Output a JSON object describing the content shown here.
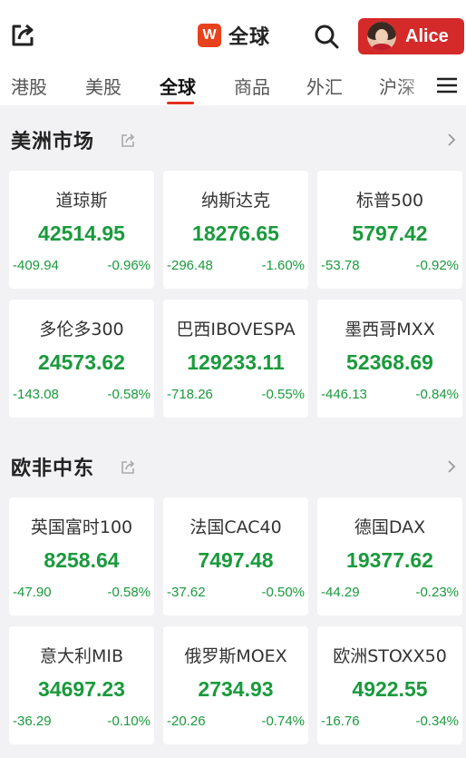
{
  "header": {
    "title": "全球",
    "logo_letter": "W",
    "user_name": "Alice"
  },
  "tabs": [
    {
      "label": "港股"
    },
    {
      "label": "美股"
    },
    {
      "label": "全球",
      "active": true
    },
    {
      "label": "商品"
    },
    {
      "label": "外汇"
    },
    {
      "label": "沪深"
    }
  ],
  "colors": {
    "accent_red": "#d42a2a",
    "down_green": "#1a9a3c",
    "brand_orange": "#e8421d"
  },
  "icons": {
    "share": "share-icon",
    "search": "search-icon",
    "menu": "menu-icon",
    "external_link": "external-link-icon",
    "chevron_right": "chevron-right-icon"
  },
  "sections": [
    {
      "title": "美洲市场",
      "cards": [
        {
          "name": "道琼斯",
          "price": "42514.95",
          "change": "-409.94",
          "change_pct": "-0.96%"
        },
        {
          "name": "纳斯达克",
          "price": "18276.65",
          "change": "-296.48",
          "change_pct": "-1.60%"
        },
        {
          "name": "标普500",
          "price": "5797.42",
          "change": "-53.78",
          "change_pct": "-0.92%"
        },
        {
          "name": "多伦多300",
          "price": "24573.62",
          "change": "-143.08",
          "change_pct": "-0.58%"
        },
        {
          "name": "巴西IBOVESPA",
          "price": "129233.11",
          "change": "-718.26",
          "change_pct": "-0.55%"
        },
        {
          "name": "墨西哥MXX",
          "price": "52368.69",
          "change": "-446.13",
          "change_pct": "-0.84%"
        }
      ]
    },
    {
      "title": "欧非中东",
      "cards": [
        {
          "name": "英国富时100",
          "price": "8258.64",
          "change": "-47.90",
          "change_pct": "-0.58%"
        },
        {
          "name": "法国CAC40",
          "price": "7497.48",
          "change": "-37.62",
          "change_pct": "-0.50%"
        },
        {
          "name": "德国DAX",
          "price": "19377.62",
          "change": "-44.29",
          "change_pct": "-0.23%"
        },
        {
          "name": "意大利MIB",
          "price": "34697.23",
          "change": "-36.29",
          "change_pct": "-0.10%"
        },
        {
          "name": "俄罗斯MOEX",
          "price": "2734.93",
          "change": "-20.26",
          "change_pct": "-0.74%"
        },
        {
          "name": "欧洲STOXX50",
          "price": "4922.55",
          "change": "-16.76",
          "change_pct": "-0.34%"
        }
      ]
    }
  ]
}
